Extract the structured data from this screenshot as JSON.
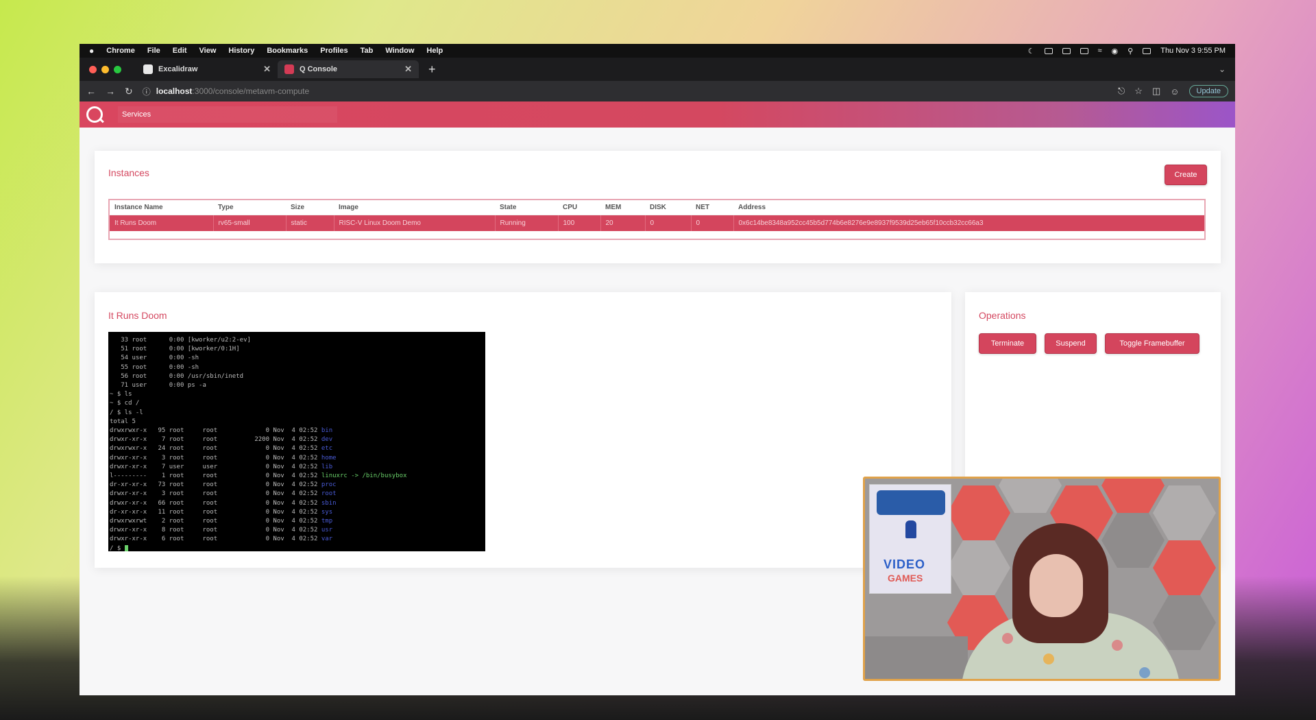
{
  "menubar": {
    "apple": "",
    "items": [
      "Chrome",
      "File",
      "Edit",
      "View",
      "History",
      "Bookmarks",
      "Profiles",
      "Tab",
      "Window",
      "Help"
    ],
    "clock": "Thu Nov 3 9:55 PM"
  },
  "tabs": [
    {
      "label": "Excalidraw",
      "active": false
    },
    {
      "label": "Q Console",
      "active": true
    }
  ],
  "address": {
    "host": "localhost",
    "path": ":3000/console/metavm-compute",
    "update_label": "Update"
  },
  "app": {
    "services_label": "Services"
  },
  "instances": {
    "title": "Instances",
    "create_label": "Create",
    "columns": [
      "Instance Name",
      "Type",
      "Size",
      "Image",
      "State",
      "CPU",
      "MEM",
      "DISK",
      "NET",
      "Address"
    ],
    "rows": [
      [
        "It Runs Doom",
        "rv65-small",
        "static",
        "RISC-V Linux Doom Demo",
        "Running",
        "100",
        "20",
        "0",
        "0",
        "0x6c14be8348a952cc45b5d774b6e8276e9e8937f9539d25eb65f10ccb32cc66a3"
      ]
    ]
  },
  "runs": {
    "title": "It Runs Doom",
    "terminal_lines": [
      {
        "text": "   33 root      0:00 [kworker/u2:2-ev]"
      },
      {
        "text": "   51 root      0:00 [kworker/0:1H]"
      },
      {
        "text": "   54 user      0:00 -sh"
      },
      {
        "text": "   55 root      0:00 -sh"
      },
      {
        "text": "   56 root      0:00 /usr/sbin/inetd"
      },
      {
        "text": "   71 user      0:00 ps -a"
      },
      {
        "text": "~ $ ls"
      },
      {
        "text": "~ $ cd /"
      },
      {
        "text": "/ $ ls -l"
      },
      {
        "text": "total 5"
      },
      {
        "text": "drwxrwxr-x   95 root     root             0 Nov  4 02:52 ",
        "tail": "bin",
        "tail_color": "blue"
      },
      {
        "text": "drwxr-xr-x    7 root     root          2200 Nov  4 02:52 ",
        "tail": "dev",
        "tail_color": "blue"
      },
      {
        "text": "drwxrwxr-x   24 root     root             0 Nov  4 02:52 ",
        "tail": "etc",
        "tail_color": "blue"
      },
      {
        "text": "drwxr-xr-x    3 root     root             0 Nov  4 02:52 ",
        "tail": "home",
        "tail_color": "blue"
      },
      {
        "text": "drwxr-xr-x    7 user     user             0 Nov  4 02:52 ",
        "tail": "lib",
        "tail_color": "blue"
      },
      {
        "text": "l---------    1 root     root             0 Nov  4 02:52 ",
        "tail": "linuxrc -> /bin/busybox",
        "tail_color": "green"
      },
      {
        "text": "dr-xr-xr-x   73 root     root             0 Nov  4 02:52 ",
        "tail": "proc",
        "tail_color": "blue"
      },
      {
        "text": "drwxr-xr-x    3 root     root             0 Nov  4 02:52 ",
        "tail": "root",
        "tail_color": "blue"
      },
      {
        "text": "drwxr-xr-x   66 root     root             0 Nov  4 02:52 ",
        "tail": "sbin",
        "tail_color": "blue"
      },
      {
        "text": "dr-xr-xr-x   11 root     root             0 Nov  4 02:52 ",
        "tail": "sys",
        "tail_color": "blue"
      },
      {
        "text": "drwxrwxrwt    2 root     root             0 Nov  4 02:52 ",
        "tail": "tmp",
        "tail_color": "blue"
      },
      {
        "text": "drwxr-xr-x    8 root     root             0 Nov  4 02:52 ",
        "tail": "usr",
        "tail_color": "blue"
      },
      {
        "text": "drwxr-xr-x    6 root     root             0 Nov  4 02:52 ",
        "tail": "var",
        "tail_color": "blue"
      },
      {
        "text": "/ $ ",
        "cursor": true
      }
    ]
  },
  "operations": {
    "title": "Operations",
    "buttons": [
      "Terminate",
      "Suspend",
      "Toggle Framebuffer"
    ]
  },
  "webcam": {
    "poster_line1": "VIDEO",
    "poster_line2": "GAMES"
  },
  "colors": {
    "accent": "#d4455d",
    "header_end": "#9b55c8",
    "webcam_border": "#e0a24a"
  }
}
